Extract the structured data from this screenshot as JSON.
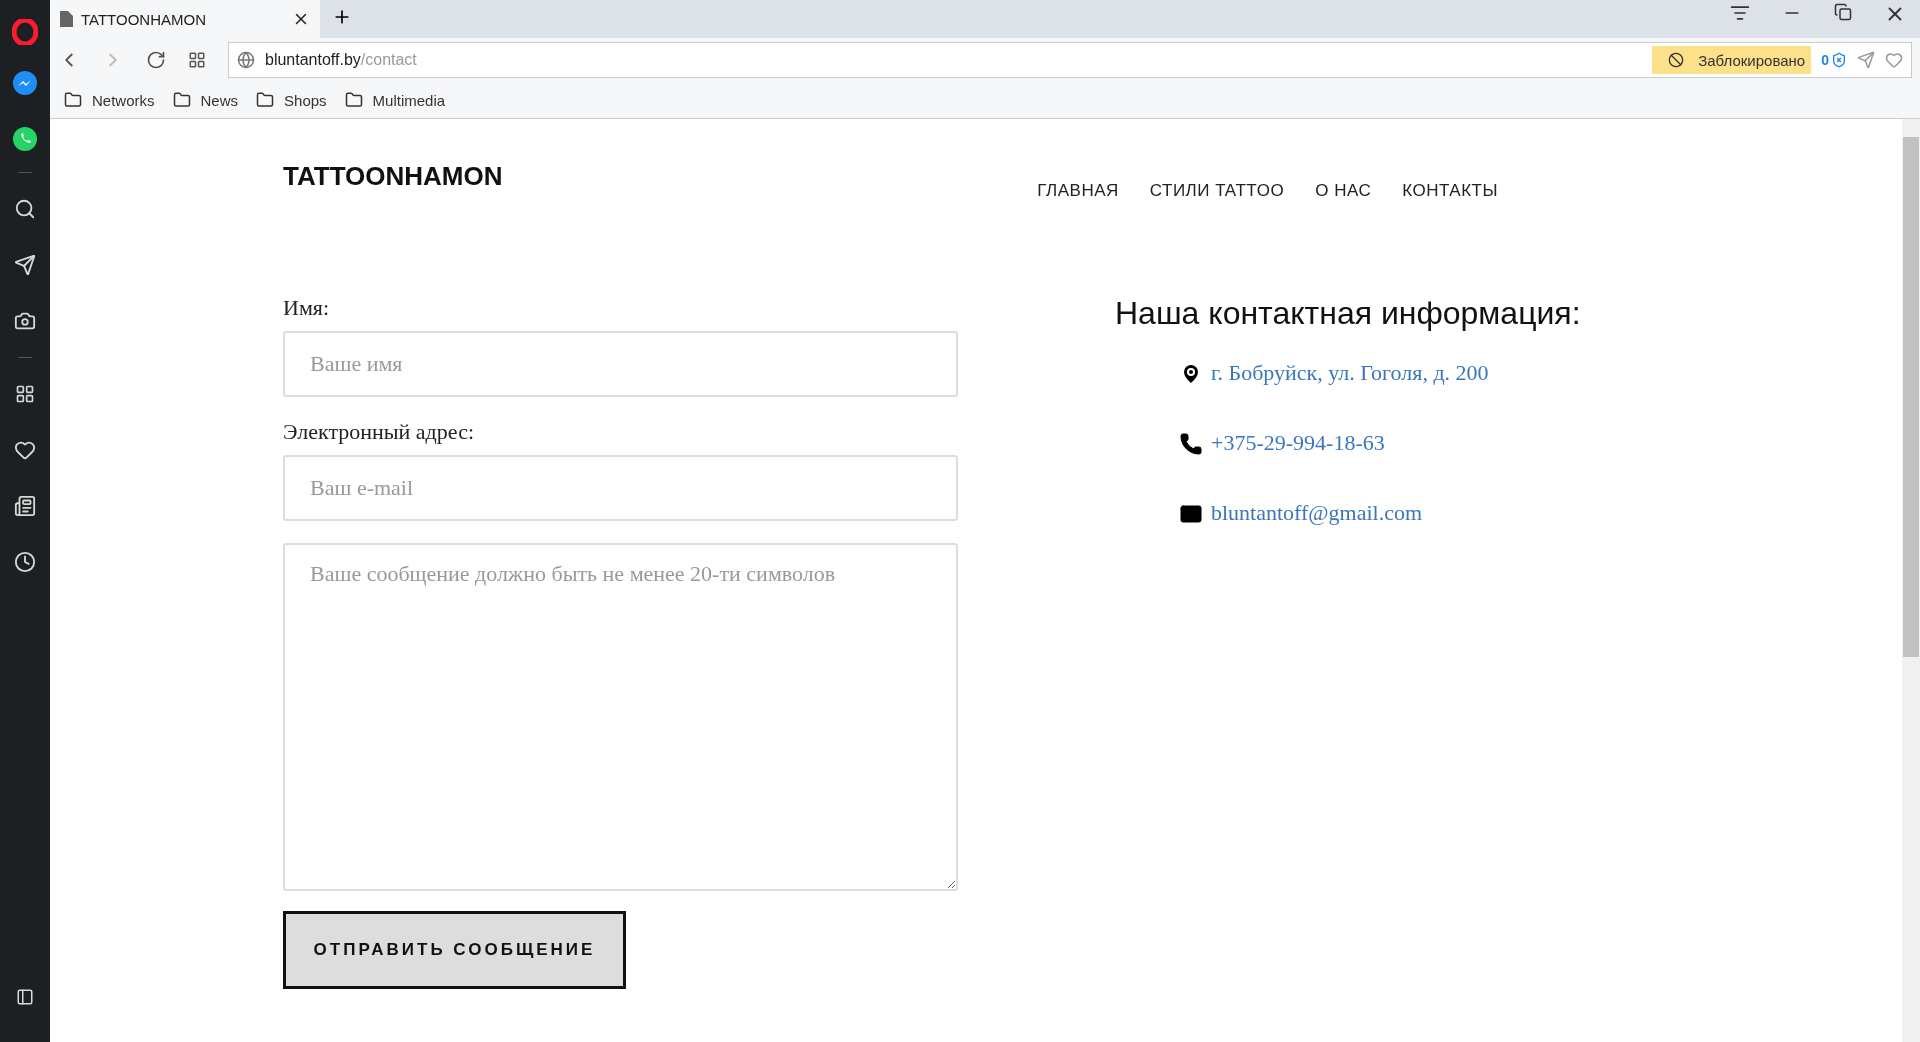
{
  "browser": {
    "tabs": [
      {
        "title": "TATTOONHAMON",
        "selected": true
      }
    ],
    "address": {
      "domain": "bluntantoff.by",
      "path": "/contact"
    },
    "blocker": {
      "label": "Заблокировано",
      "count": "0"
    },
    "bookmarks": [
      "Networks",
      "News",
      "Shops",
      "Multimedia"
    ]
  },
  "site": {
    "logo": "TATTOONHAMON",
    "nav": [
      "ГЛАВНАЯ",
      "СТИЛИ TATTOO",
      "О НАС",
      "КОНТАКТЫ"
    ],
    "form": {
      "fields": [
        {
          "kind": "input",
          "label": "Имя:",
          "placeholder": "Ваше имя"
        },
        {
          "kind": "input",
          "label": "Электронный адрес:",
          "placeholder": "Ваш e-mail"
        },
        {
          "kind": "textarea",
          "placeholder": "Ваше сообщение должно быть не менее 20-ти символов"
        }
      ],
      "submit": "ОТПРАВИТЬ СООБЩЕНИЕ"
    },
    "contact": {
      "heading": "Наша контактная информация:",
      "items": [
        {
          "kind": "address",
          "text": "г. Бобруйск, ул. Гоголя, д. 200"
        },
        {
          "kind": "phone",
          "text": "+375-29-994-18-63"
        },
        {
          "kind": "email",
          "text": "bluntantoff@gmail.com"
        }
      ]
    }
  }
}
